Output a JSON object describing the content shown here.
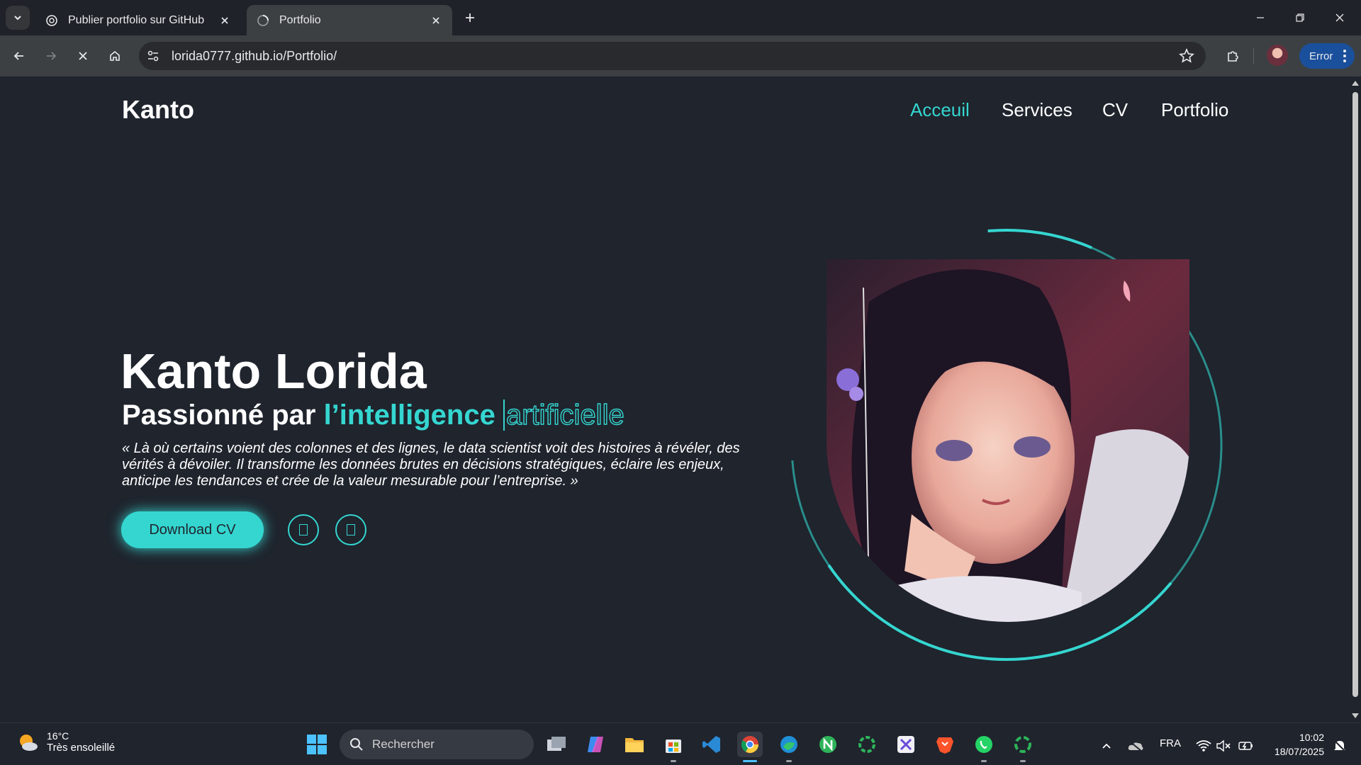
{
  "browser": {
    "tabs": [
      {
        "title": "Publier portfolio sur GitHub",
        "active": false,
        "favicon": "openai-icon"
      },
      {
        "title": "Portfolio",
        "active": true,
        "favicon": "loading-globe-icon"
      }
    ],
    "url": "lorida0777.github.io/Portfolio/",
    "error_label": "Error"
  },
  "site": {
    "logo": "Kanto",
    "nav": [
      "Acceuil",
      "Services",
      "CV",
      "Portfolio"
    ],
    "active_nav": "Acceuil",
    "hero": {
      "name": "Kanto Lorida",
      "subtitle_prefix": "Passionné par ",
      "subtitle_accent": "l’intelligence",
      "subtitle_typed": "artificielle",
      "quote": "« Là où certains voient des colonnes et des lignes, le data scientist voit des histoires à révéler, des vérités à dévoiler. Il transforme les données brutes en décisions stratégiques, éclaire les enjeux, anticipe les tendances et crée de la valeur mesurable pour l’entreprise. »",
      "download_label": "Download CV",
      "social_icons": [
        "social-icon-1",
        "social-icon-2"
      ]
    },
    "colors": {
      "accent": "#35d6d0",
      "background": "#1f242d"
    }
  },
  "taskbar": {
    "weather_temp": "16°C",
    "weather_desc": "Très ensoleillé",
    "search_placeholder": "Rechercher",
    "apps": [
      "task-view",
      "copilot",
      "file-explorer",
      "microsoft-store",
      "vscode",
      "chrome",
      "edge",
      "notion",
      "loader-app",
      "snipping-tool",
      "brave",
      "whatsapp",
      "loader-app-2"
    ],
    "language": "FRA",
    "time": "10:02",
    "date": "18/07/2025"
  }
}
